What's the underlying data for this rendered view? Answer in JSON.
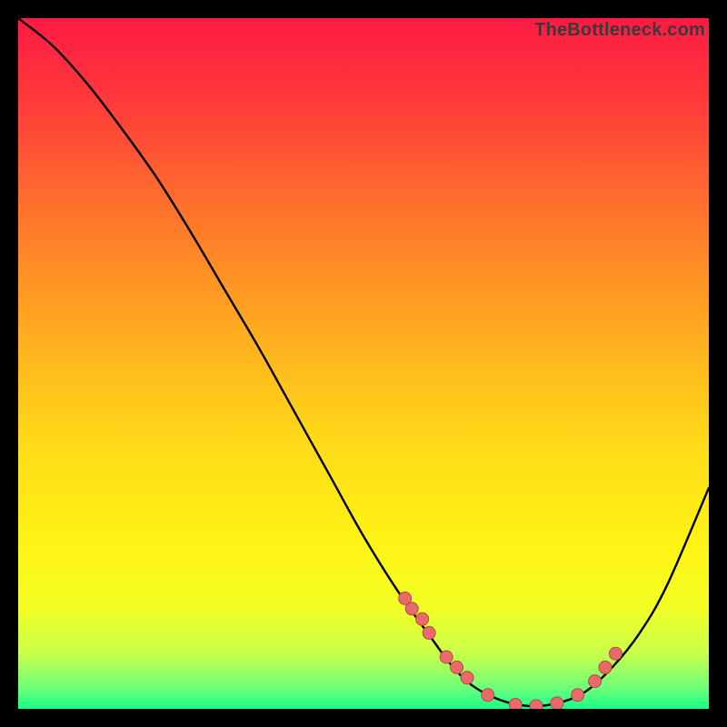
{
  "watermark": "TheBottleneck.com",
  "chart_data": {
    "type": "line",
    "title": "",
    "xlabel": "",
    "ylabel": "",
    "xlim": [
      0,
      100
    ],
    "ylim": [
      0,
      100
    ],
    "curve": {
      "x": [
        0,
        5,
        10,
        15,
        20,
        25,
        30,
        35,
        40,
        45,
        50,
        55,
        60,
        63,
        66,
        70,
        74,
        78,
        82,
        86,
        90,
        94,
        100
      ],
      "y": [
        100,
        96,
        90.5,
        84,
        77,
        69,
        60.5,
        52,
        43,
        34,
        25,
        17,
        10,
        6,
        3.2,
        1.2,
        0.4,
        0.8,
        2.4,
        6,
        11,
        18,
        32
      ]
    },
    "markers": {
      "x": [
        56,
        57,
        58.5,
        59.5,
        62,
        63.5,
        65,
        68,
        72,
        75,
        78,
        81,
        83.5,
        85,
        86.5
      ],
      "y": [
        16,
        14.5,
        13,
        11,
        7.5,
        6,
        4.5,
        2,
        0.6,
        0.4,
        0.8,
        2,
        4,
        6,
        8
      ]
    },
    "gradient_stops": [
      {
        "offset": 0.0,
        "color": "#ff1a44"
      },
      {
        "offset": 0.12,
        "color": "#ff3a3a"
      },
      {
        "offset": 0.3,
        "color": "#ff7a2a"
      },
      {
        "offset": 0.48,
        "color": "#ffb41e"
      },
      {
        "offset": 0.62,
        "color": "#ffdc18"
      },
      {
        "offset": 0.76,
        "color": "#fff314"
      },
      {
        "offset": 0.85,
        "color": "#f4ff24"
      },
      {
        "offset": 0.92,
        "color": "#c9ff4a"
      },
      {
        "offset": 0.97,
        "color": "#6cff7a"
      },
      {
        "offset": 1.0,
        "color": "#1aff88"
      }
    ],
    "marker_color": "#e86a6a",
    "marker_stroke": "#b84848",
    "curve_color": "#000000"
  }
}
